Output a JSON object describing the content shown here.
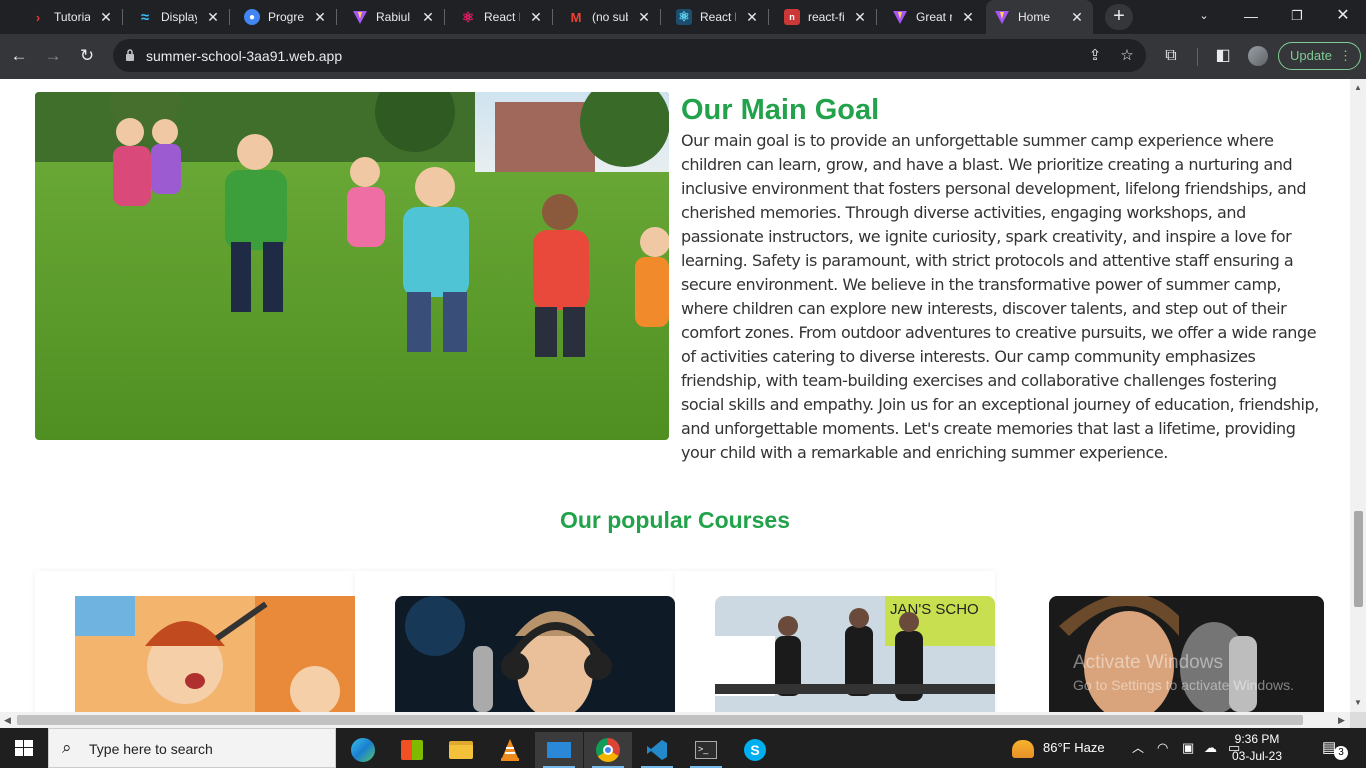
{
  "browser": {
    "tabs": [
      {
        "title": "Tutorial",
        "icon": "chevron-icon",
        "color": "#e53935"
      },
      {
        "title": "Display",
        "icon": "tailwind-icon",
        "color": "#38bdf8"
      },
      {
        "title": "Progress",
        "icon": "progress-icon",
        "color": "#4285f4"
      },
      {
        "title": "Rabiul",
        "icon": "vite-icon",
        "color": "#a855f7"
      },
      {
        "title": "React I",
        "icon": "react-icon",
        "color": "#e91e63"
      },
      {
        "title": "(no sub",
        "icon": "gmail-icon",
        "color": "#ea4335"
      },
      {
        "title": "React F",
        "icon": "react-icon",
        "color": "#61dafb"
      },
      {
        "title": "react-fi",
        "icon": "npm-icon",
        "color": "#cb3837"
      },
      {
        "title": "Great r",
        "icon": "vite-icon",
        "color": "#a855f7"
      },
      {
        "title": "Home",
        "icon": "vite-icon",
        "color": "#a855f7"
      }
    ],
    "url": "summer-school-3aa91.web.app",
    "update_label": "Update"
  },
  "page": {
    "goal_title": "Our Main Goal",
    "goal_text": "Our main goal is to provide an unforgettable summer camp experience where children can learn, grow, and have a blast. We prioritize creating a nurturing and inclusive environment that fosters personal development, lifelong friendships, and cherished memories. Through diverse activities, engaging workshops, and passionate instructors, we ignite curiosity, spark creativity, and inspire a love for learning. Safety is paramount, with strict protocols and attentive staff ensuring a secure environment. We believe in the transformative power of summer camp, where children can explore new interests, discover talents, and step out of their comfort zones. From outdoor adventures to creative pursuits, we offer a wide range of activities catering to diverse interests. Our camp community emphasizes friendship, with team-building exercises and collaborative challenges fostering social skills and empathy. Join us for an exceptional journey of education, friendship, and unforgettable moments. Let's create memories that last a lifetime, providing your child with a remarkable and enriching summer experience.",
    "courses_title": "Our popular Courses",
    "course_sign_text": "JAN'S SCHO"
  },
  "watermark": {
    "line1": "Activate Windows",
    "line2": "Go to Settings to activate Windows."
  },
  "taskbar": {
    "search_placeholder": "Type here to search",
    "weather": "86°F  Haze",
    "time": "9:36 PM",
    "date": "03-Jul-23",
    "notification_count": "3"
  }
}
